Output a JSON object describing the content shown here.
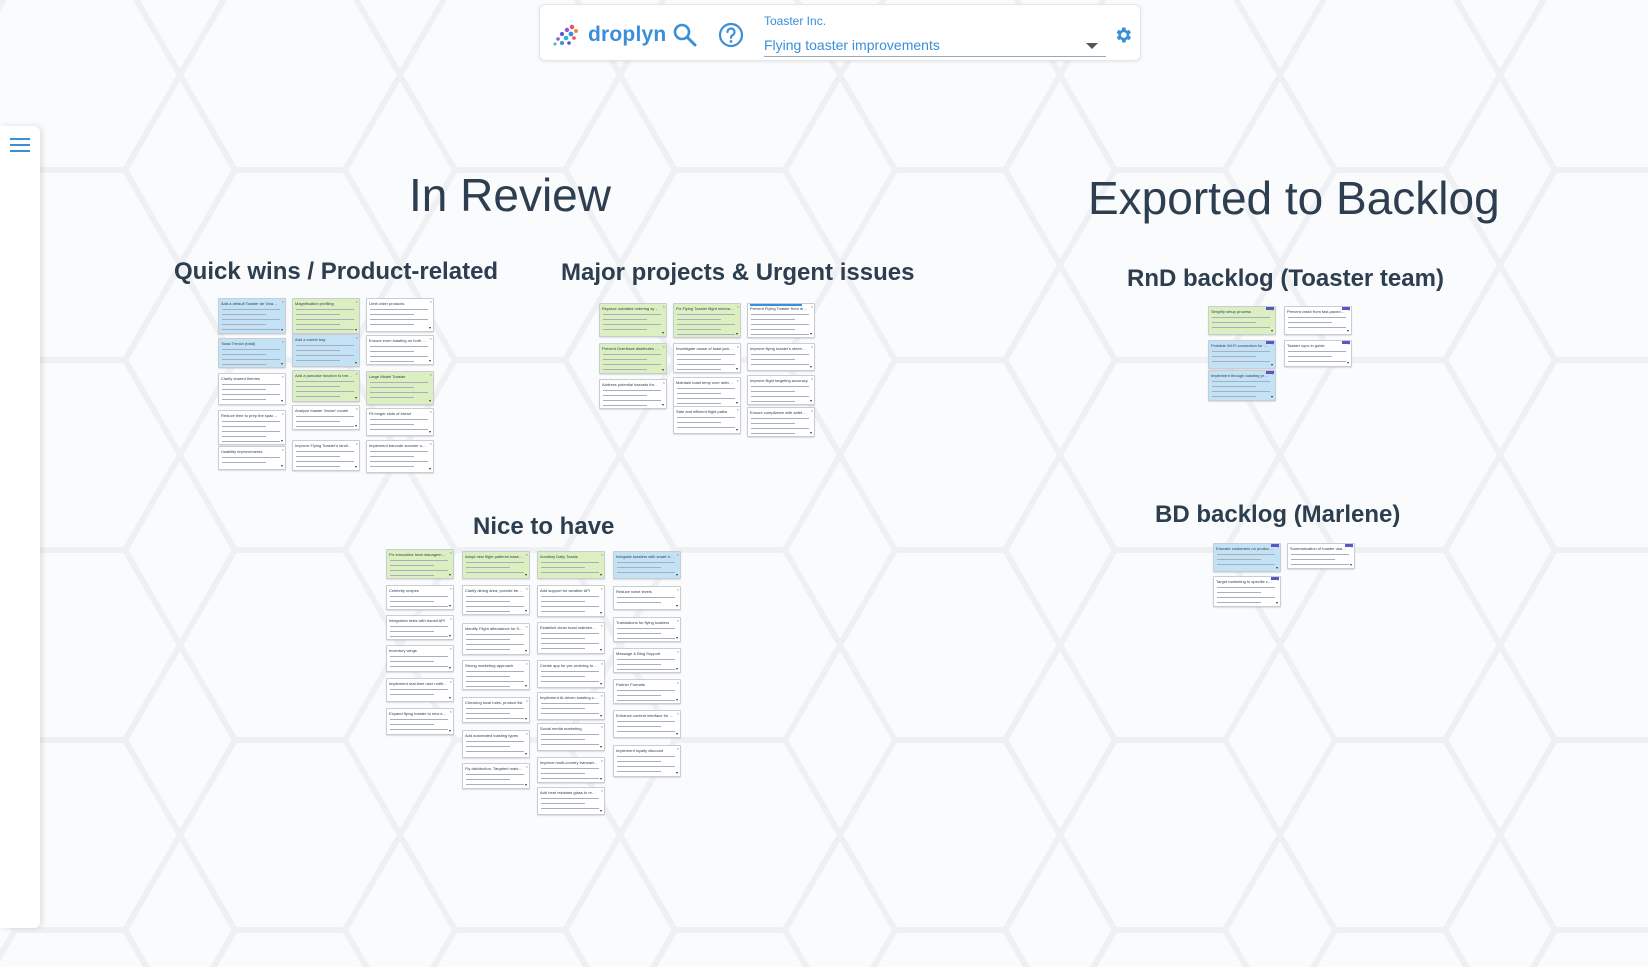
{
  "app": {
    "logo_text": "droplyn",
    "org_label": "Toaster Inc.",
    "project_value": "Flying toaster improvements",
    "accent_color": "#3a8fd8",
    "icons": {
      "search": "search-icon",
      "help": "help-circle-icon",
      "settings": "gear-icon",
      "menu": "hamburger-menu-icon",
      "dropdown": "caret-down-icon"
    }
  },
  "boards": {
    "in_review": "In Review",
    "exported": "Exported to Backlog"
  },
  "clusters": {
    "quick_wins": "Quick wins / Product-related",
    "major": "Major projects & Urgent issues",
    "nice": "Nice to have",
    "rnd": "RnD backlog (Toaster team)",
    "bd": "BD backlog (Marlene)"
  },
  "cards": {
    "qw": [
      "Add a default Toaster de Vivaan bread",
      "Magnification profiling",
      "Limit order products",
      "Toast Trench (total)",
      "Add a crumb tray",
      "Ensure even toasting on both sides",
      "Clarify shared themes",
      "Add a pancake function to breakfast",
      "Large Model Toaster",
      "Reduce time to prep the space saving storage solutions",
      "Analyze toaster 'brown' model",
      "Fit longer slots of bread",
      "Usability improvements",
      "Improve Flying Toaster's landing speed and conformity",
      "Implement barcode scanner on our toast in commercial units"
    ],
    "major": [
      "Replace outdated ordering system",
      "Fix Flying Toaster flight mechanism ('who flies, I crash')",
      "Prevent Flying Toaster from dropping toast",
      "Prevent Overflows distributes from dropping toast pieces",
      "Investigate cause of toast jamming",
      "Improve flying toaster's steering radius",
      "Address potential hazards through regular testing",
      "Maintain toast temp over delivery process",
      "Improve flight targeting accuracy",
      "Safe and efficient flight paths",
      "Ensure compliance with safety regulations"
    ],
    "nice": [
      "Fix Innovative heat management to products packaging",
      "Adopt new flight patterns based on user feedback",
      "Auxiliary Daily Toasts",
      "Integrate toasters with smart home ecosystem",
      "Celebrity recipes",
      "Clarify dining area, provide best tables",
      "Add support for weather API",
      "Reduce noise levels",
      "Integration tests with transit API",
      "Identify Flight attendance for flying toasters",
      "Establish clean toast maintenance",
      "Translations for flying toasters",
      "Inventory wings",
      "Strong marketing approach",
      "Create app for pre-ordering toasting",
      "Message & Blog Support",
      "Implement real-time user notification",
      "Checking local rules, product list",
      "Implement AI-driven toasting consistency",
      "Partner Formats",
      "Expand flying toaster to new sales territory",
      "Add automated toasting types",
      "Social media marketing",
      "Enhance content interface for crispy results",
      "Fly distribution, Targeted marketing strategy",
      "Improve multi-country transaction handling",
      "Implement loyalty discount",
      "Add heat resistant glass to reduce fingerprints"
    ],
    "rnd": [
      "Simplify setup process",
      "Prevent crash from fast-paced product failures",
      "Portable Wi-Fi connection for remote",
      "Toaster sync in guide",
      "Implement through toasting process to address potential hazards"
    ],
    "bd": [
      "Educate customers on product usage, especially the flying and maintenance features",
      "Summarization of toaster usage assessment",
      "Target marketing to specific customer segments to drive sales in international markets"
    ]
  }
}
